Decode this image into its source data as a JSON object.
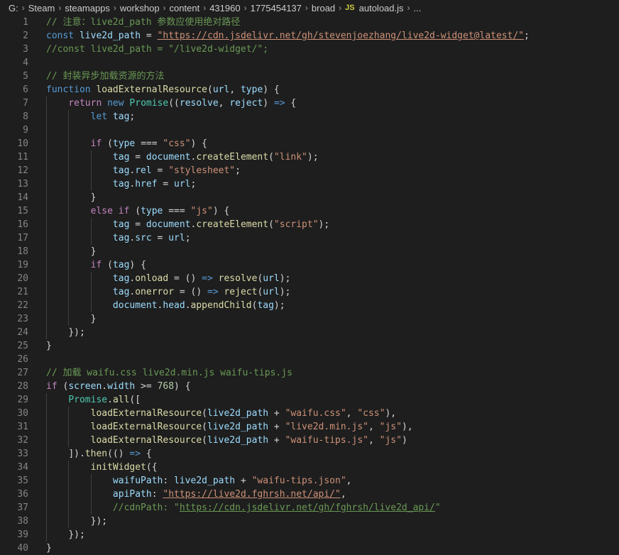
{
  "breadcrumb": {
    "items": [
      "G:",
      "Steam",
      "steamapps",
      "workshop",
      "content",
      "431960",
      "1775454137",
      "broad"
    ],
    "file_icon": "JS",
    "file_name": "autoload.js",
    "trailing": "..."
  },
  "editor": {
    "language": "javascript",
    "lines": [
      {
        "num": "1",
        "indent": 0,
        "tokens": [
          [
            "cm",
            "// 注意：live2d_path 参数应使用绝对路径"
          ]
        ]
      },
      {
        "num": "2",
        "indent": 0,
        "tokens": [
          [
            "k",
            "const"
          ],
          [
            "p",
            " "
          ],
          [
            "v",
            "live2d_path"
          ],
          [
            "p",
            " = "
          ],
          [
            "s u",
            "\"https://cdn.jsdelivr.net/gh/stevenjoezhang/live2d-widget@latest/\""
          ],
          [
            "p",
            ";"
          ]
        ]
      },
      {
        "num": "3",
        "indent": 0,
        "tokens": [
          [
            "cm",
            "//const live2d_path = \"/live2d-widget/\";"
          ]
        ]
      },
      {
        "num": "4",
        "indent": 0,
        "tokens": []
      },
      {
        "num": "5",
        "indent": 0,
        "tokens": [
          [
            "cm",
            "// 封装异步加载资源的方法"
          ]
        ]
      },
      {
        "num": "6",
        "indent": 0,
        "tokens": [
          [
            "k",
            "function"
          ],
          [
            "p",
            " "
          ],
          [
            "f",
            "loadExternalResource"
          ],
          [
            "p",
            "("
          ],
          [
            "v",
            "url"
          ],
          [
            "p",
            ", "
          ],
          [
            "v",
            "type"
          ],
          [
            "p",
            ") {"
          ]
        ]
      },
      {
        "num": "7",
        "indent": 1,
        "tokens": [
          [
            "c",
            "return"
          ],
          [
            "p",
            " "
          ],
          [
            "k",
            "new"
          ],
          [
            "p",
            " "
          ],
          [
            "t",
            "Promise"
          ],
          [
            "p",
            "(("
          ],
          [
            "v",
            "resolve"
          ],
          [
            "p",
            ", "
          ],
          [
            "v",
            "reject"
          ],
          [
            "p",
            ") "
          ],
          [
            "k",
            "=>"
          ],
          [
            "p",
            " {"
          ]
        ]
      },
      {
        "num": "8",
        "indent": 2,
        "tokens": [
          [
            "k",
            "let"
          ],
          [
            "p",
            " "
          ],
          [
            "v",
            "tag"
          ],
          [
            "p",
            ";"
          ]
        ]
      },
      {
        "num": "9",
        "indent": 2,
        "tokens": []
      },
      {
        "num": "10",
        "indent": 2,
        "tokens": [
          [
            "c",
            "if"
          ],
          [
            "p",
            " ("
          ],
          [
            "v",
            "type"
          ],
          [
            "p",
            " === "
          ],
          [
            "s",
            "\"css\""
          ],
          [
            "p",
            ") {"
          ]
        ]
      },
      {
        "num": "11",
        "indent": 3,
        "tokens": [
          [
            "v",
            "tag"
          ],
          [
            "p",
            " = "
          ],
          [
            "v",
            "document"
          ],
          [
            "p",
            "."
          ],
          [
            "f",
            "createElement"
          ],
          [
            "p",
            "("
          ],
          [
            "s",
            "\"link\""
          ],
          [
            "p",
            ");"
          ]
        ]
      },
      {
        "num": "12",
        "indent": 3,
        "tokens": [
          [
            "v",
            "tag"
          ],
          [
            "p",
            "."
          ],
          [
            "v",
            "rel"
          ],
          [
            "p",
            " = "
          ],
          [
            "s",
            "\"stylesheet\""
          ],
          [
            "p",
            ";"
          ]
        ]
      },
      {
        "num": "13",
        "indent": 3,
        "tokens": [
          [
            "v",
            "tag"
          ],
          [
            "p",
            "."
          ],
          [
            "v",
            "href"
          ],
          [
            "p",
            " = "
          ],
          [
            "v",
            "url"
          ],
          [
            "p",
            ";"
          ]
        ]
      },
      {
        "num": "14",
        "indent": 2,
        "tokens": [
          [
            "p",
            "}"
          ]
        ]
      },
      {
        "num": "15",
        "indent": 2,
        "tokens": [
          [
            "c",
            "else"
          ],
          [
            "p",
            " "
          ],
          [
            "c",
            "if"
          ],
          [
            "p",
            " ("
          ],
          [
            "v",
            "type"
          ],
          [
            "p",
            " === "
          ],
          [
            "s",
            "\"js\""
          ],
          [
            "p",
            ") {"
          ]
        ]
      },
      {
        "num": "16",
        "indent": 3,
        "tokens": [
          [
            "v",
            "tag"
          ],
          [
            "p",
            " = "
          ],
          [
            "v",
            "document"
          ],
          [
            "p",
            "."
          ],
          [
            "f",
            "createElement"
          ],
          [
            "p",
            "("
          ],
          [
            "s",
            "\"script\""
          ],
          [
            "p",
            ");"
          ]
        ]
      },
      {
        "num": "17",
        "indent": 3,
        "tokens": [
          [
            "v",
            "tag"
          ],
          [
            "p",
            "."
          ],
          [
            "v",
            "src"
          ],
          [
            "p",
            " = "
          ],
          [
            "v",
            "url"
          ],
          [
            "p",
            ";"
          ]
        ]
      },
      {
        "num": "18",
        "indent": 2,
        "tokens": [
          [
            "p",
            "}"
          ]
        ]
      },
      {
        "num": "19",
        "indent": 2,
        "tokens": [
          [
            "c",
            "if"
          ],
          [
            "p",
            " ("
          ],
          [
            "v",
            "tag"
          ],
          [
            "p",
            ") {"
          ]
        ]
      },
      {
        "num": "20",
        "indent": 3,
        "tokens": [
          [
            "v",
            "tag"
          ],
          [
            "p",
            "."
          ],
          [
            "f",
            "onload"
          ],
          [
            "p",
            " = () "
          ],
          [
            "k",
            "=>"
          ],
          [
            "p",
            " "
          ],
          [
            "f",
            "resolve"
          ],
          [
            "p",
            "("
          ],
          [
            "v",
            "url"
          ],
          [
            "p",
            ");"
          ]
        ]
      },
      {
        "num": "21",
        "indent": 3,
        "tokens": [
          [
            "v",
            "tag"
          ],
          [
            "p",
            "."
          ],
          [
            "f",
            "onerror"
          ],
          [
            "p",
            " = () "
          ],
          [
            "k",
            "=>"
          ],
          [
            "p",
            " "
          ],
          [
            "f",
            "reject"
          ],
          [
            "p",
            "("
          ],
          [
            "v",
            "url"
          ],
          [
            "p",
            ");"
          ]
        ]
      },
      {
        "num": "22",
        "indent": 3,
        "tokens": [
          [
            "v",
            "document"
          ],
          [
            "p",
            "."
          ],
          [
            "v",
            "head"
          ],
          [
            "p",
            "."
          ],
          [
            "f",
            "appendChild"
          ],
          [
            "p",
            "("
          ],
          [
            "v",
            "tag"
          ],
          [
            "p",
            ");"
          ]
        ]
      },
      {
        "num": "23",
        "indent": 2,
        "tokens": [
          [
            "p",
            "}"
          ]
        ]
      },
      {
        "num": "24",
        "indent": 1,
        "tokens": [
          [
            "p",
            "});"
          ]
        ]
      },
      {
        "num": "25",
        "indent": 0,
        "tokens": [
          [
            "p",
            "}"
          ]
        ]
      },
      {
        "num": "26",
        "indent": 0,
        "tokens": []
      },
      {
        "num": "27",
        "indent": 0,
        "tokens": [
          [
            "cm",
            "// 加载 waifu.css live2d.min.js waifu-tips.js"
          ]
        ]
      },
      {
        "num": "28",
        "indent": 0,
        "tokens": [
          [
            "c",
            "if"
          ],
          [
            "p",
            " ("
          ],
          [
            "v",
            "screen"
          ],
          [
            "p",
            "."
          ],
          [
            "v",
            "width"
          ],
          [
            "p",
            " >= "
          ],
          [
            "n",
            "768"
          ],
          [
            "p",
            ") {"
          ]
        ]
      },
      {
        "num": "29",
        "indent": 1,
        "tokens": [
          [
            "t",
            "Promise"
          ],
          [
            "p",
            "."
          ],
          [
            "f",
            "all"
          ],
          [
            "p",
            "(["
          ]
        ]
      },
      {
        "num": "30",
        "indent": 2,
        "tokens": [
          [
            "f",
            "loadExternalResource"
          ],
          [
            "p",
            "("
          ],
          [
            "v",
            "live2d_path"
          ],
          [
            "p",
            " + "
          ],
          [
            "s",
            "\"waifu.css\""
          ],
          [
            "p",
            ", "
          ],
          [
            "s",
            "\"css\""
          ],
          [
            "p",
            "),"
          ]
        ]
      },
      {
        "num": "31",
        "indent": 2,
        "tokens": [
          [
            "f",
            "loadExternalResource"
          ],
          [
            "p",
            "("
          ],
          [
            "v",
            "live2d_path"
          ],
          [
            "p",
            " + "
          ],
          [
            "s",
            "\"live2d.min.js\""
          ],
          [
            "p",
            ", "
          ],
          [
            "s",
            "\"js\""
          ],
          [
            "p",
            "),"
          ]
        ]
      },
      {
        "num": "32",
        "indent": 2,
        "tokens": [
          [
            "f",
            "loadExternalResource"
          ],
          [
            "p",
            "("
          ],
          [
            "v",
            "live2d_path"
          ],
          [
            "p",
            " + "
          ],
          [
            "s",
            "\"waifu-tips.js\""
          ],
          [
            "p",
            ", "
          ],
          [
            "s",
            "\"js\""
          ],
          [
            "p",
            ")"
          ]
        ]
      },
      {
        "num": "33",
        "indent": 1,
        "tokens": [
          [
            "p",
            "])."
          ],
          [
            "f",
            "then"
          ],
          [
            "p",
            "(() "
          ],
          [
            "k",
            "=>"
          ],
          [
            "p",
            " {"
          ]
        ]
      },
      {
        "num": "34",
        "indent": 2,
        "tokens": [
          [
            "f",
            "initWidget"
          ],
          [
            "p",
            "({"
          ]
        ]
      },
      {
        "num": "35",
        "indent": 3,
        "tokens": [
          [
            "v",
            "waifuPath"
          ],
          [
            "p",
            ": "
          ],
          [
            "v",
            "live2d_path"
          ],
          [
            "p",
            " + "
          ],
          [
            "s",
            "\"waifu-tips.json\""
          ],
          [
            "p",
            ","
          ]
        ]
      },
      {
        "num": "36",
        "indent": 3,
        "tokens": [
          [
            "v",
            "apiPath"
          ],
          [
            "p",
            ": "
          ],
          [
            "s u",
            "\"https://live2d.fghrsh.net/api/\""
          ],
          [
            "p",
            ","
          ]
        ]
      },
      {
        "num": "37",
        "indent": 3,
        "tokens": [
          [
            "cm",
            "//cdnPath: \""
          ],
          [
            "cm u",
            "https://cdn.jsdelivr.net/gh/fghrsh/live2d_api/"
          ],
          [
            "cm",
            "\""
          ]
        ]
      },
      {
        "num": "38",
        "indent": 2,
        "tokens": [
          [
            "p",
            "});"
          ]
        ]
      },
      {
        "num": "39",
        "indent": 1,
        "tokens": [
          [
            "p",
            "});"
          ]
        ]
      },
      {
        "num": "40",
        "indent": 0,
        "tokens": [
          [
            "p",
            "}"
          ]
        ]
      }
    ]
  }
}
